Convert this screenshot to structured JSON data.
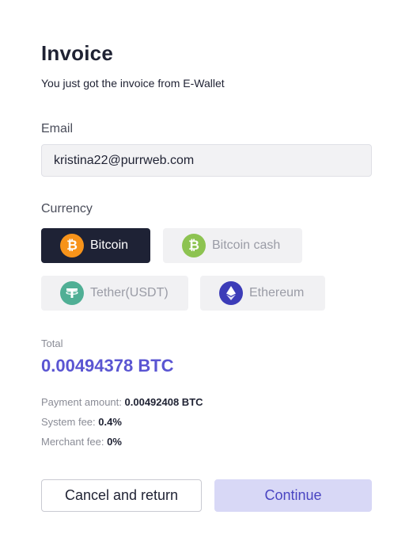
{
  "header": {
    "title": "Invoice",
    "subtitle": "You just got the invoice from E-Wallet"
  },
  "email": {
    "label": "Email",
    "value": "kristina22@purrweb.com"
  },
  "currency": {
    "label": "Currency",
    "selected": "Bitcoin",
    "options": [
      {
        "label": "Bitcoin",
        "icon": "bitcoin-icon",
        "color": "#f7931a",
        "glyph": "₿"
      },
      {
        "label": "Bitcoin cash",
        "icon": "bitcoin-cash-icon",
        "color": "#8dc351",
        "glyph": "₿"
      },
      {
        "label": "Tether(USDT)",
        "icon": "tether-icon",
        "color": "#50af95",
        "glyph": "T"
      },
      {
        "label": "Ethereum",
        "icon": "ethereum-icon",
        "color": "#3c3cb8",
        "glyph": "◆"
      }
    ]
  },
  "total": {
    "label": "Total",
    "value": "0.00494378 BTC"
  },
  "fees": {
    "payment_label": "Payment amount:",
    "payment_value": "0.00492408 BTC",
    "system_label": "System fee:",
    "system_value": "0.4%",
    "merchant_label": "Merchant fee:",
    "merchant_value": "0%"
  },
  "actions": {
    "cancel_label": "Cancel and return",
    "continue_label": "Continue"
  },
  "colors": {
    "accent": "#5a55d2",
    "selected_chip": "#1e2235",
    "continue_bg": "#d8d8f6"
  }
}
